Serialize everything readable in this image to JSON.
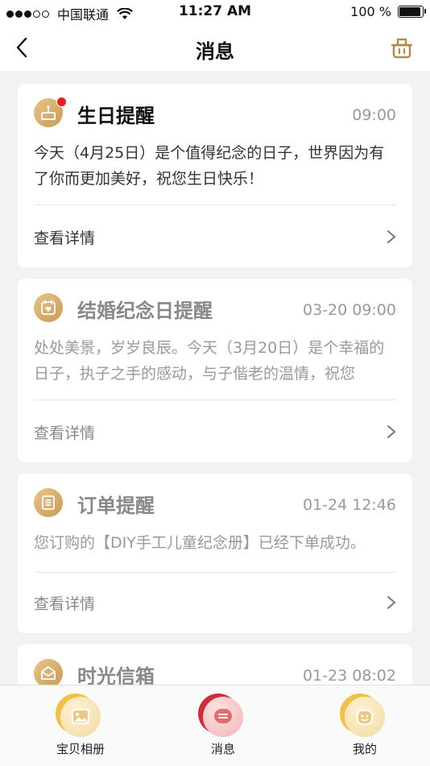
{
  "status_bar": {
    "carrier": "中国联通",
    "time": "11:27 AM",
    "battery_text": "100 %"
  },
  "nav": {
    "title": "消息"
  },
  "messages": [
    {
      "title": "生日提醒",
      "time": "09:00",
      "body": "今天（4月25日）是个值得纪念的日子，世界因为有了你而更加美好，祝您生日快乐！",
      "detail": "查看详情",
      "icon": "cake-icon",
      "unread": true
    },
    {
      "title": "结婚纪念日提醒",
      "time": "03-20 09:00",
      "body": "处处美景，岁岁良辰。今天（3月20日）是个幸福的日子，执子之手的感动，与子偕老的温情，祝您",
      "detail": "查看详情",
      "icon": "calendar-heart-icon",
      "unread": false
    },
    {
      "title": "订单提醒",
      "time": "01-24 12:46",
      "body": "您订购的【DIY手工儿童纪念册】已经下单成功。",
      "detail": "查看详情",
      "icon": "order-list-icon",
      "unread": false
    },
    {
      "title": "时光信箱",
      "time": "01-23 08:02",
      "icon": "mailbox-icon",
      "unread": false
    }
  ],
  "tabs": [
    {
      "label": "宝贝相册",
      "icon": "photo-album-icon",
      "active": false
    },
    {
      "label": "消息",
      "icon": "message-icon",
      "active": true
    },
    {
      "label": "我的",
      "icon": "profile-icon",
      "active": false
    }
  ],
  "colors": {
    "accent_gold": "#d4a865",
    "active_red": "#c8303a",
    "unread_dot": "#ea1b24"
  }
}
